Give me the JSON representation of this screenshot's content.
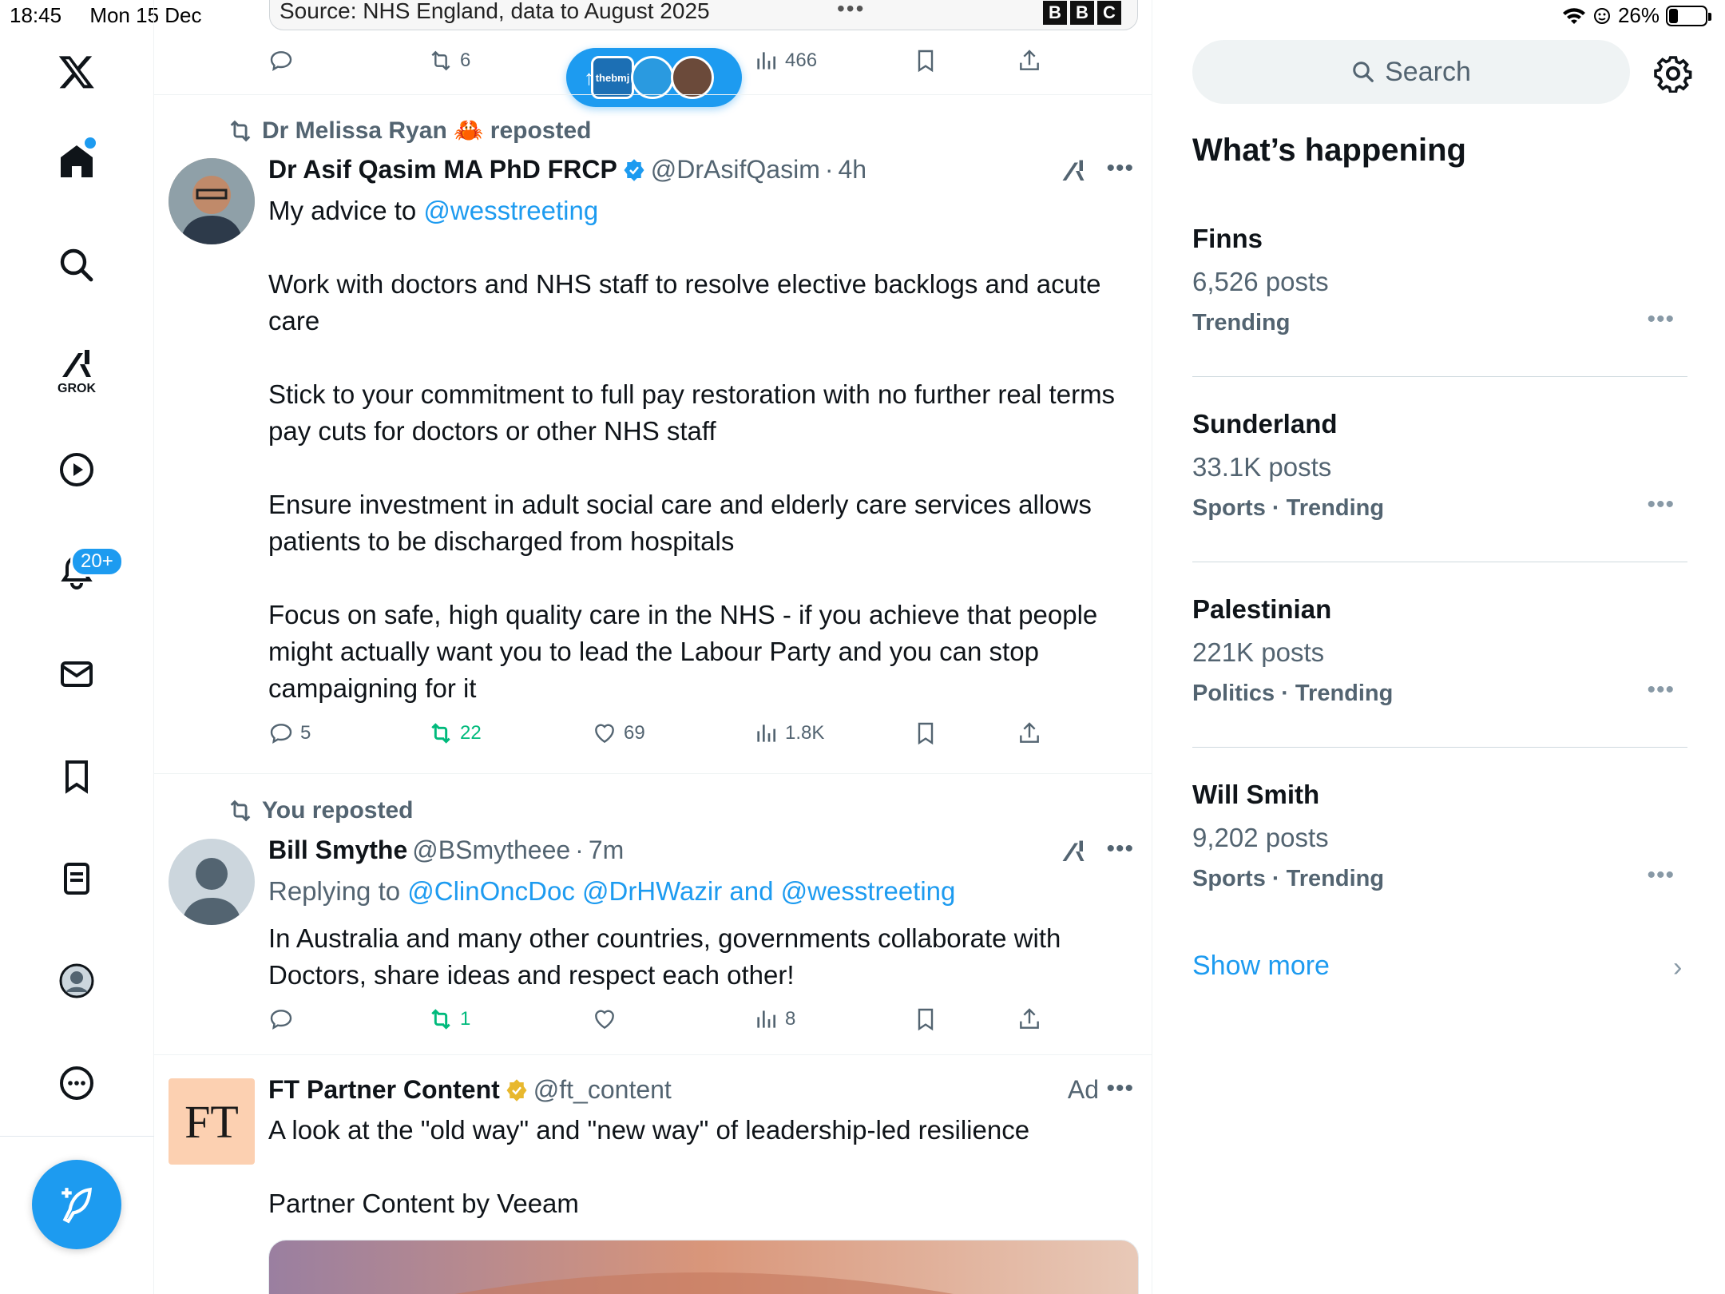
{
  "status_bar": {
    "time": "18:45",
    "date": "Mon 15 Dec",
    "battery": "26%",
    "battery_level": 0.26
  },
  "nav": {
    "notifications_badge": "20+",
    "grok_label": "GROK"
  },
  "top_banner": {
    "source_text": "Source: NHS England, data to August 2025",
    "brand_letters": [
      "B",
      "B",
      "C"
    ]
  },
  "prev_tweet_actions": {
    "retweets": "6",
    "views": "466"
  },
  "new_posts_pill": {
    "avatar_text": "thebmj"
  },
  "tweets": [
    {
      "repost_by": "Dr Melissa Ryan 🦀 reposted",
      "name": "Dr Asif Qasim MA PhD FRCP",
      "handle": "@DrAsifQasim",
      "time": "4h",
      "intro": "My advice to ",
      "mention": "@wesstreeting",
      "paragraphs": [
        "Work with doctors and NHS staff to resolve elective backlogs and acute care",
        "Stick to your commitment to full pay restoration with no further real terms pay cuts for doctors or other NHS staff",
        "Ensure investment in adult social care and elderly care services allows patients to be discharged from hospitals",
        "Focus on safe, high quality care in the NHS - if you achieve that people might actually want you to lead the Labour Party and you can stop campaigning for it"
      ],
      "replies": "5",
      "retweets": "22",
      "likes": "69",
      "views": "1.8K"
    },
    {
      "repost_by": "You reposted",
      "name": "Bill Smythe",
      "handle": "@BSmytheee",
      "time": "7m",
      "replying_prefix": "Replying to ",
      "replying_to": "@ClinOncDoc @DrHWazir and @wesstreeting",
      "text": "In Australia and many other countries, governments collaborate with Doctors, share ideas and respect each other!",
      "retweets": "1",
      "views": "8"
    }
  ],
  "ad": {
    "logo": "FT",
    "name": "FT Partner Content",
    "handle": "@ft_content",
    "label": "Ad",
    "text": "A look at the \"old way\" and \"new way\" of leadership-led resilience",
    "subtext": "Partner Content by Veeam"
  },
  "sidebar": {
    "search_placeholder": "Search",
    "heading": "What’s happening",
    "trends": [
      {
        "topic": "Finns",
        "posts": "6,526 posts",
        "meta": "Trending"
      },
      {
        "topic": "Sunderland",
        "posts": "33.1K posts",
        "meta": "Sports · Trending"
      },
      {
        "topic": "Palestinian",
        "posts": "221K posts",
        "meta": "Politics · Trending"
      },
      {
        "topic": "Will Smith",
        "posts": "9,202 posts",
        "meta": "Sports · Trending"
      }
    ],
    "show_more": "Show more"
  },
  "colors": {
    "accent": "#1d9bf0",
    "retweet_green": "#00ba7c",
    "muted": "#536471",
    "ft_pink": "#fcd0b1"
  }
}
